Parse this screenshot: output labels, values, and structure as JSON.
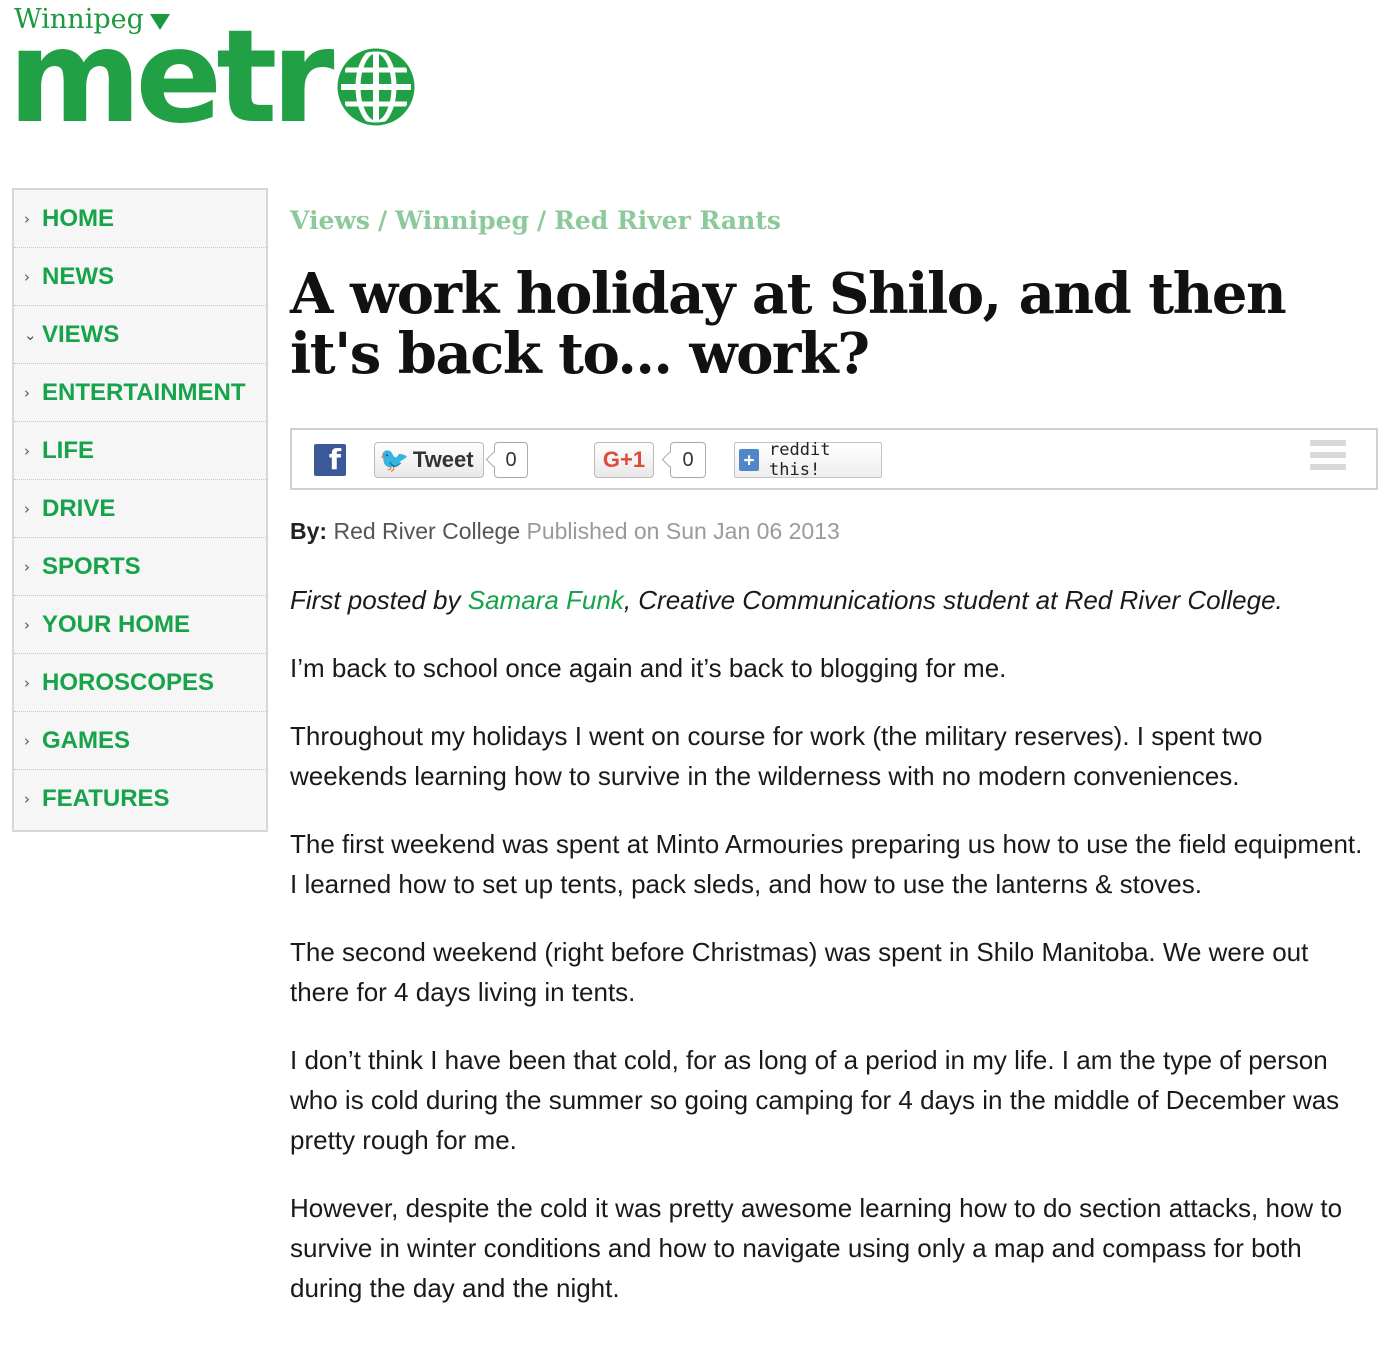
{
  "header": {
    "edition": "Winnipeg",
    "logo_text": "metr"
  },
  "nav": {
    "items": [
      {
        "label": "HOME",
        "chevron": "›"
      },
      {
        "label": "NEWS",
        "chevron": "›"
      },
      {
        "label": "VIEWS",
        "chevron": "⌄"
      },
      {
        "label": "ENTERTAINMENT",
        "chevron": "›"
      },
      {
        "label": "LIFE",
        "chevron": "›"
      },
      {
        "label": "DRIVE",
        "chevron": "›"
      },
      {
        "label": "SPORTS",
        "chevron": "›"
      },
      {
        "label": "YOUR HOME",
        "chevron": "›"
      },
      {
        "label": "HOROSCOPES",
        "chevron": "›"
      },
      {
        "label": "GAMES",
        "chevron": "›"
      },
      {
        "label": "FEATURES",
        "chevron": "›"
      }
    ]
  },
  "breadcrumb": [
    "Views",
    "Winnipeg",
    "Red River Rants"
  ],
  "breadcrumb_sep": "/",
  "article": {
    "headline": "A work holiday at Shilo, and then it's back to... work?",
    "byline_label": "By:",
    "author": "Red River College",
    "published": "Published on Sun Jan 06 2013",
    "intro_prefix": "First posted by ",
    "intro_link": "Samara Funk",
    "intro_suffix": ", Creative Communications student at Red River College.",
    "paragraphs": [
      "I’m back to school once again and it’s back to blogging for me.",
      "Throughout my holidays I went on course for work (the military reserves). I spent two weekends learning how to survive in the wilderness with no modern conveniences.",
      "The first weekend was spent at Minto Armouries preparing us how to use the field equipment. I learned how to set up tents, pack sleds, and how to use the lanterns & stoves.",
      "The second weekend (right before Christmas) was spent in Shilo Manitoba. We were out there for 4 days living in tents.",
      "I don’t think I have been that cold, for as long of a period in my life. I am the type of person who is cold during the summer so going camping for 4 days in the middle of December was pretty rough for me.",
      "However, despite the cold it was pretty awesome learning how to do section attacks, how to survive in winter conditions and how to navigate using only a map and compass for both during the day and the night."
    ]
  },
  "share": {
    "facebook_glyph": "f",
    "tweet_label": "Tweet",
    "tweet_count": "0",
    "gplus_label": "G+1",
    "gplus_count": "0",
    "reddit_label": "reddit this!"
  },
  "colors": {
    "brand_green": "#22a046",
    "nav_green": "#16a34a",
    "breadcrumb_green": "#8cc99b",
    "facebook_blue": "#3b5998",
    "twitter_blue": "#1da1f2"
  },
  "icons": [
    "dropdown-triangle-icon",
    "globe-icon",
    "facebook-icon",
    "twitter-bird-icon",
    "reddit-plus-icon",
    "menu-icon",
    "chevron-right-icon",
    "chevron-down-icon"
  ]
}
